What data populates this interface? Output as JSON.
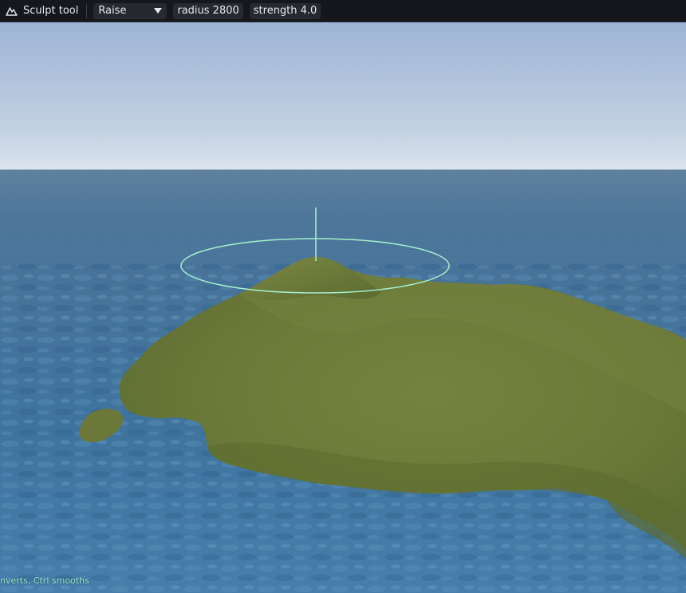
{
  "toolbar": {
    "tool_icon": "mountain-icon",
    "tool_title": "Sculpt tool",
    "mode": {
      "selected": "Raise",
      "icon": "chevron-down-icon"
    },
    "radius_label": "radius 2800",
    "strength_label": "strength 4.0"
  },
  "viewport": {
    "scene": "terrain-island-over-ocean",
    "brush_cursor": "brush-ring",
    "colors": {
      "sky_top": "#9fb6d8",
      "sky_horizon": "#d8e2ec",
      "ocean": "#3d6f97",
      "terrain": "#6d7a39",
      "brush": "#a6f0d0"
    }
  },
  "status_hint": "nverts, Ctrl smooths"
}
